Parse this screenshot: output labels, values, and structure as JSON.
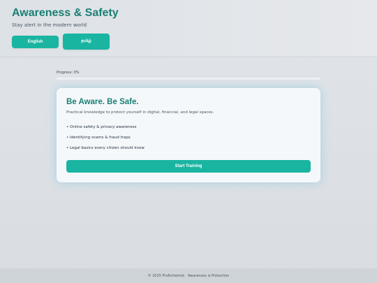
{
  "header": {
    "title": "Awareness & Safety",
    "tagline": "Stay alert in the modern world",
    "languages": [
      {
        "label": "English"
      },
      {
        "label": "தமிழ்"
      }
    ]
  },
  "progress": {
    "label": "Progress: 0%",
    "value_percent": 0
  },
  "card": {
    "title": "Be Aware. Be Safe.",
    "description": "Practical knowledge to protect yourself in digital, financial, and legal spaces.",
    "features": [
      "• Online safety & privacy awareness",
      "• Identifying scams & fraud traps",
      "• Legal basics every citizen should know"
    ],
    "start_label": "Start Training"
  },
  "footer": {
    "text": "© 2025 FinAlchemist · Awareness is Protection"
  },
  "colors": {
    "accent": "#1ab5a1",
    "title": "#1a7f73"
  }
}
